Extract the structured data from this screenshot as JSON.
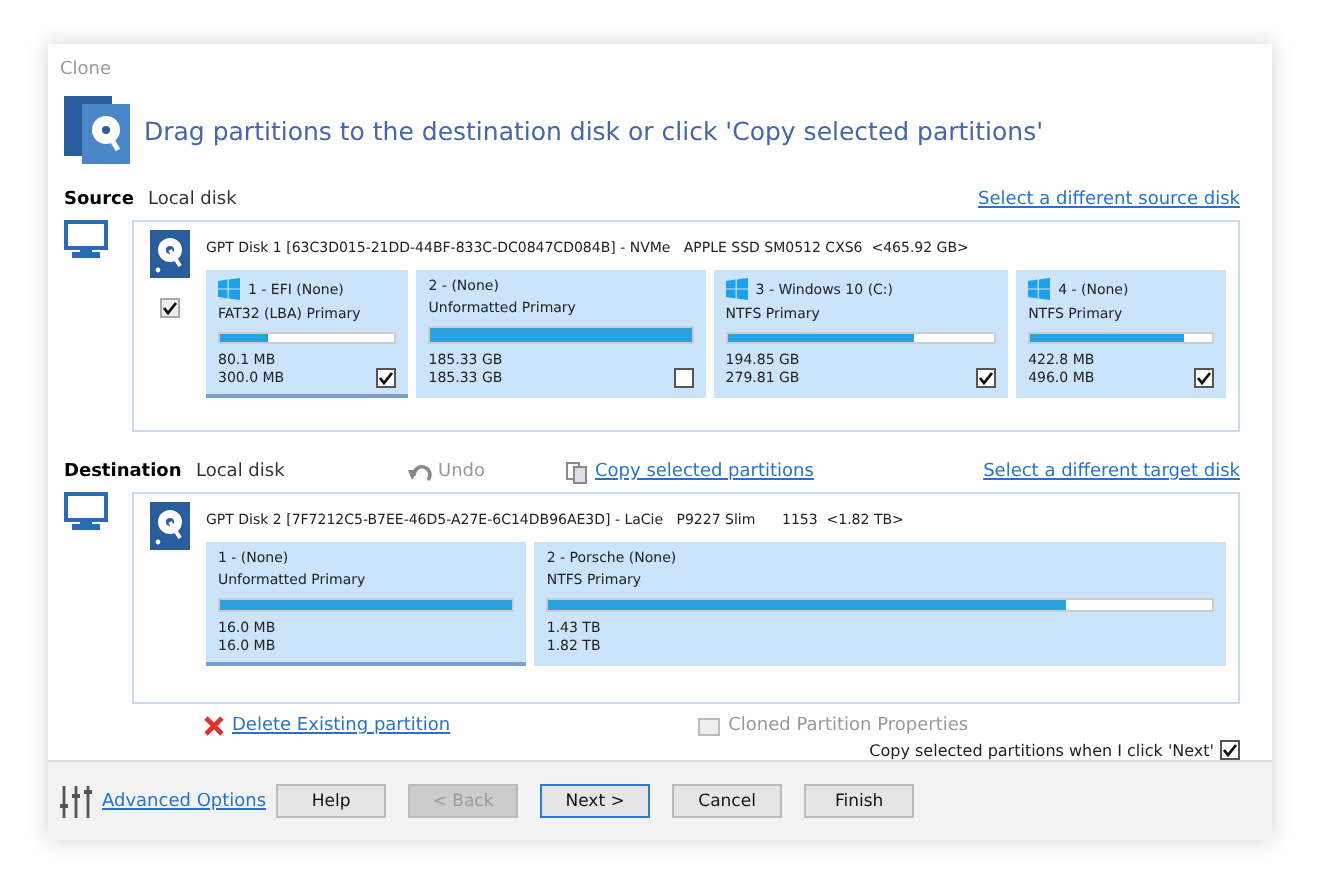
{
  "window": {
    "title": "Clone"
  },
  "header": "Drag partitions to the destination disk or click 'Copy selected partitions'",
  "source": {
    "label": "Source",
    "type": "Local disk",
    "link": "Select a different source disk",
    "disk": "GPT Disk 1 [63C3D015-21DD-44BF-833C-DC0847CD084B] - NVMe   APPLE SSD SM0512 CXS6  <465.92 GB>",
    "disk_checked": true,
    "partitions": [
      {
        "name": "1 - EFI (None)",
        "windows_logo": true,
        "fs": "FAT32 (LBA) Primary",
        "level": 0.27,
        "used": "80.1 MB",
        "total": "300.0 MB",
        "checked": true,
        "selected": true
      },
      {
        "name": "2 -  (None)",
        "windows_logo": false,
        "fs": "Unformatted Primary",
        "level": 1,
        "used": "185.33 GB",
        "total": "185.33 GB",
        "checked": false,
        "selected": false
      },
      {
        "name": "3 - Windows 10 (C:)",
        "windows_logo": true,
        "fs": "NTFS Primary",
        "level": 0.7,
        "used": "194.85 GB",
        "total": "279.81 GB",
        "checked": true,
        "selected": false
      },
      {
        "name": "4 -  (None)",
        "windows_logo": true,
        "fs": "NTFS Primary",
        "level": 0.85,
        "used": "422.8 MB",
        "total": "496.0 MB",
        "checked": true,
        "selected": false
      }
    ]
  },
  "destination": {
    "label": "Destination",
    "type": "Local disk",
    "undo": "Undo",
    "copy_link": "Copy selected partitions",
    "link": "Select a different target disk",
    "disk": "GPT Disk 2 [7F7212C5-B7EE-46D5-A27E-6C14DB96AE3D] - LaCie   P9227 Slim      1153  <1.82 TB>",
    "partitions": [
      {
        "name": "1 -  (None)",
        "fs": "Unformatted Primary",
        "level": 1,
        "used": "16.0 MB",
        "total": "16.0 MB",
        "selected": true
      },
      {
        "name": "2 - Porsche (None)",
        "fs": "NTFS Primary",
        "level": 0.78,
        "used": "1.43 TB",
        "total": "1.82 TB",
        "selected": false
      }
    ]
  },
  "actions": {
    "delete": "Delete Existing partition",
    "properties": "Cloned Partition Properties"
  },
  "copy_on_next": {
    "label": "Copy selected partitions when I click 'Next'",
    "checked": true
  },
  "footer": {
    "advanced": "Advanced Options",
    "buttons": [
      {
        "label": "Help",
        "disabled": false,
        "default": false
      },
      {
        "label": "< Back",
        "disabled": true,
        "default": false
      },
      {
        "label": "Next >",
        "disabled": false,
        "default": true
      },
      {
        "label": "Cancel",
        "disabled": false,
        "default": false
      },
      {
        "label": "Finish",
        "disabled": false,
        "default": false
      }
    ]
  }
}
